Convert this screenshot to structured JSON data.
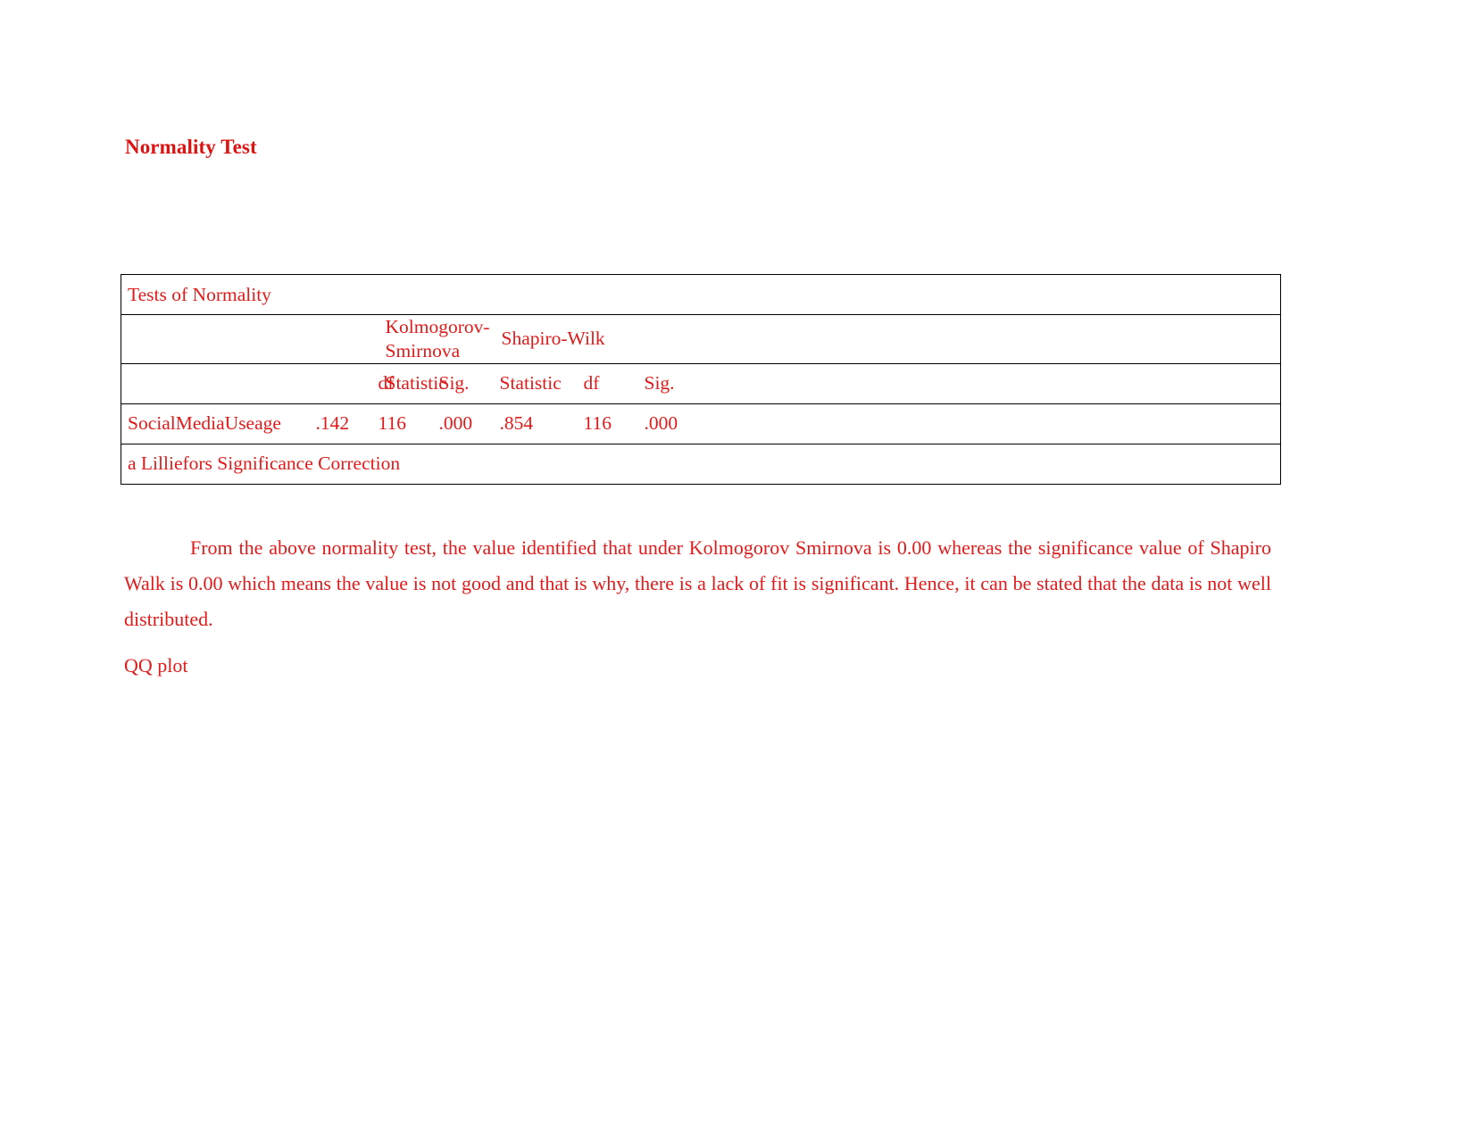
{
  "document": {
    "heading": "Normality Test",
    "section_label": "QQ plot"
  },
  "table": {
    "caption": "Tests of Normality",
    "group_headers": {
      "blank": "",
      "kolmogorov": "Kolmogorov-Smirnova",
      "shapiro": "Shapiro-Wilk"
    },
    "column_headers": {
      "blank": "",
      "ks_statistic": "Statistic",
      "ks_df": "df",
      "ks_sig": "Sig.",
      "sw_statistic": "Statistic",
      "sw_df": "df",
      "sw_sig": "Sig."
    },
    "rows": [
      {
        "label": "SocialMediaUseage",
        "ks_statistic": ".142",
        "ks_df": "116",
        "ks_sig": ".000",
        "sw_statistic": ".854",
        "sw_df": "116",
        "sw_sig": ".000"
      }
    ],
    "footnote": "a Lilliefors Significance Correction"
  },
  "paragraph": {
    "text": "From the above normality test, the value identified that under Kolmogorov Smirnova is 0.00 whereas the significance value of Shapiro Walk is 0.00 which means the value is not good and that is why, there is a lack of fit is significant. Hence, it can be stated that the data is not well distributed."
  },
  "colors": {
    "text_red": "#e01b1b",
    "heading_red": "#dd1212",
    "border_black": "#000000",
    "page_background": "#ffffff"
  }
}
